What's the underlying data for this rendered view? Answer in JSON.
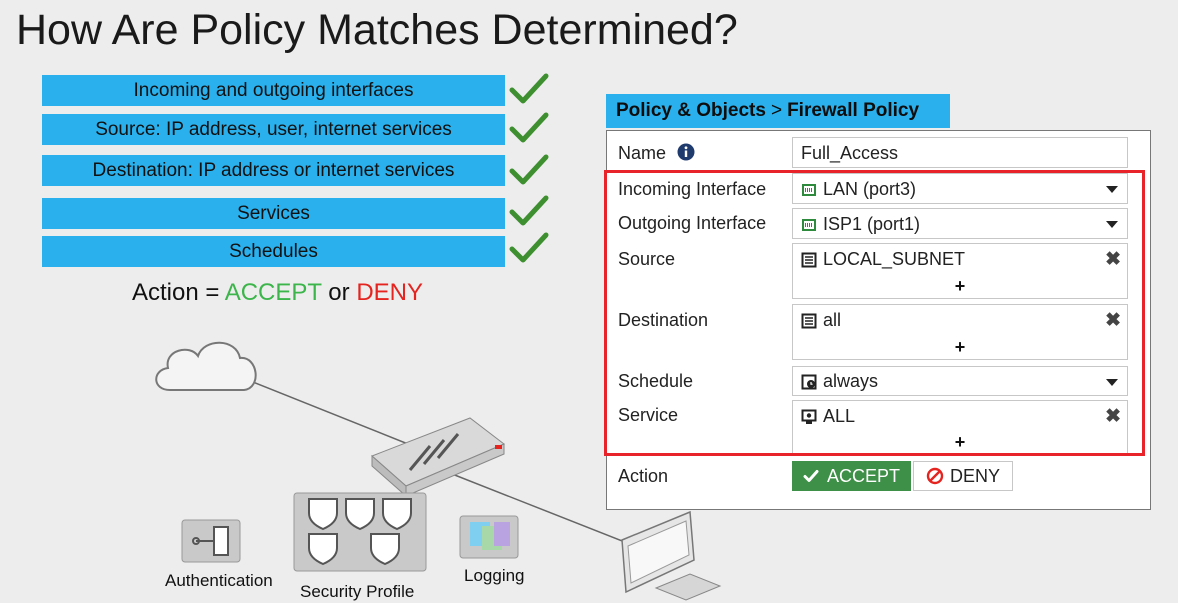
{
  "title": "How Are Policy Matches Determined?",
  "criteria": [
    "Incoming and outgoing interfaces",
    "Source: IP address, user, internet services",
    "Destination: IP address or internet services",
    "Services",
    "Schedules"
  ],
  "action_line": {
    "prefix": "Action = ",
    "accept": "ACCEPT",
    "middle": " or ",
    "deny": "DENY"
  },
  "diagram": {
    "authentication": "Authentication",
    "security_profile": "Security Profile",
    "logging": "Logging"
  },
  "breadcrumb": {
    "section": "Policy & Objects",
    "separator": ">",
    "page": "Firewall Policy"
  },
  "policy": {
    "name_label": "Name",
    "name_value": "Full_Access",
    "incoming_label": "Incoming Interface",
    "incoming_value": "LAN (port3)",
    "outgoing_label": "Outgoing Interface",
    "outgoing_value": "ISP1 (port1)",
    "source_label": "Source",
    "source_value": "LOCAL_SUBNET",
    "destination_label": "Destination",
    "destination_value": "all",
    "schedule_label": "Schedule",
    "schedule_value": "always",
    "service_label": "Service",
    "service_value": "ALL",
    "action_label": "Action",
    "accept_label": "ACCEPT",
    "deny_label": "DENY",
    "plus": "+",
    "remove": "✖"
  },
  "colors": {
    "accent": "#2ab0ec",
    "accept": "#3cb54a",
    "deny": "#e52420",
    "highlight": "#e8232a",
    "accept_button": "#3e8f47"
  }
}
